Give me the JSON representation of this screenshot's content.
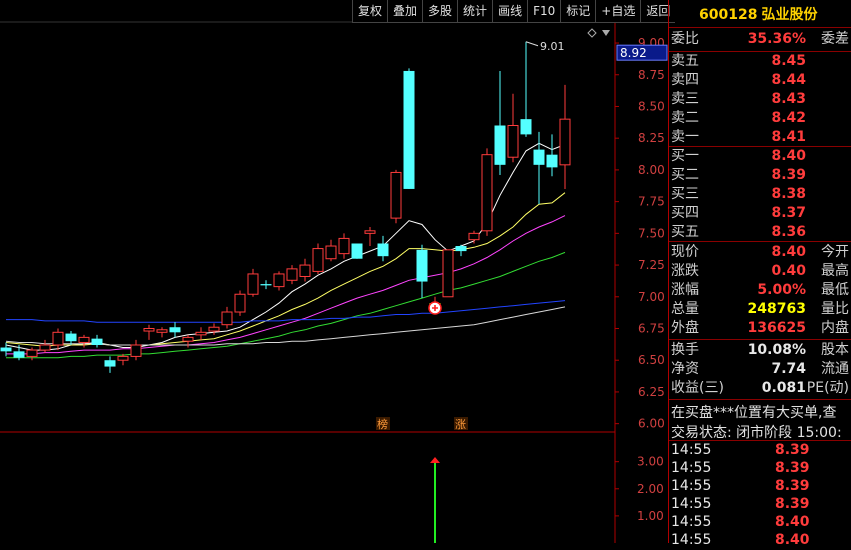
{
  "toolbar": [
    "复权",
    "叠加",
    "多股",
    "统计",
    "画线",
    "F10",
    "标记",
    "+自选",
    "返回"
  ],
  "stock": {
    "code": "600128",
    "name": "弘业股份"
  },
  "quote": {
    "ratio": {
      "label": "委比",
      "value": "35.36%",
      "label2": "委差"
    },
    "asks": [
      {
        "label": "卖五",
        "price": "8.45"
      },
      {
        "label": "卖四",
        "price": "8.44"
      },
      {
        "label": "卖三",
        "price": "8.43"
      },
      {
        "label": "卖二",
        "price": "8.42"
      },
      {
        "label": "卖一",
        "price": "8.41"
      }
    ],
    "bids": [
      {
        "label": "买一",
        "price": "8.40"
      },
      {
        "label": "买二",
        "price": "8.39"
      },
      {
        "label": "买三",
        "price": "8.38"
      },
      {
        "label": "买四",
        "price": "8.37"
      },
      {
        "label": "买五",
        "price": "8.36"
      }
    ],
    "stats": [
      {
        "label": "现价",
        "value": "8.40",
        "label2": "今开",
        "color": "red"
      },
      {
        "label": "涨跌",
        "value": "0.40",
        "label2": "最高",
        "color": "red"
      },
      {
        "label": "涨幅",
        "value": "5.00%",
        "label2": "最低",
        "color": "red"
      },
      {
        "label": "总量",
        "value": "248763",
        "label2": "量比",
        "color": "yel"
      },
      {
        "label": "外盘",
        "value": "136625",
        "label2": "内盘",
        "color": "red"
      }
    ],
    "fundamentals": [
      {
        "label": "换手",
        "value": "10.08%",
        "label2": "股本"
      },
      {
        "label": "净资",
        "value": "7.74",
        "label2": "流通"
      },
      {
        "label": "收益(三)",
        "value": "0.081",
        "label2": "PE(动)"
      }
    ],
    "scroll_note": "在买盘***位置有大买单,查",
    "trade_status": "交易状态: 闭市阶段  15:00:",
    "ticks": [
      {
        "time": "14:55",
        "price": "8.39"
      },
      {
        "time": "14:55",
        "price": "8.39"
      },
      {
        "time": "14:55",
        "price": "8.39"
      },
      {
        "time": "14:55",
        "price": "8.39"
      },
      {
        "time": "14:55",
        "price": "8.40"
      },
      {
        "time": "14:55",
        "price": "8.40"
      }
    ]
  },
  "colors": {
    "up": "#ff3c3c",
    "down": "#54ffff",
    "limit_up": "#ffff00",
    "axis": "#b00000"
  },
  "chart_data": {
    "type": "candlestick",
    "price_axis": {
      "ticks": [
        "9.00",
        "8.75",
        "8.50",
        "8.25",
        "8.00",
        "7.75",
        "7.50",
        "7.25",
        "7.00",
        "6.75",
        "6.50",
        "6.25",
        "6.00"
      ],
      "ylim": [
        5.95,
        9.15
      ]
    },
    "current_price_tag": "8.92",
    "max_label": "9.01",
    "markers": [
      "榜",
      "涨"
    ],
    "candles": [
      {
        "o": 6.6,
        "h": 6.64,
        "l": 6.53,
        "c": 6.57
      },
      {
        "o": 6.57,
        "h": 6.62,
        "l": 6.5,
        "c": 6.52
      },
      {
        "o": 6.53,
        "h": 6.6,
        "l": 6.5,
        "c": 6.58
      },
      {
        "o": 6.58,
        "h": 6.66,
        "l": 6.56,
        "c": 6.62
      },
      {
        "o": 6.62,
        "h": 6.75,
        "l": 6.58,
        "c": 6.72
      },
      {
        "o": 6.71,
        "h": 6.73,
        "l": 6.62,
        "c": 6.65
      },
      {
        "o": 6.64,
        "h": 6.7,
        "l": 6.6,
        "c": 6.68
      },
      {
        "o": 6.67,
        "h": 6.7,
        "l": 6.6,
        "c": 6.62
      },
      {
        "o": 6.5,
        "h": 6.53,
        "l": 6.4,
        "c": 6.45
      },
      {
        "o": 6.5,
        "h": 6.55,
        "l": 6.46,
        "c": 6.53
      },
      {
        "o": 6.53,
        "h": 6.66,
        "l": 6.5,
        "c": 6.62
      },
      {
        "o": 6.73,
        "h": 6.78,
        "l": 6.66,
        "c": 6.75
      },
      {
        "o": 6.72,
        "h": 6.76,
        "l": 6.68,
        "c": 6.74
      },
      {
        "o": 6.76,
        "h": 6.8,
        "l": 6.68,
        "c": 6.72
      },
      {
        "o": 6.65,
        "h": 6.7,
        "l": 6.6,
        "c": 6.68
      },
      {
        "o": 6.7,
        "h": 6.76,
        "l": 6.66,
        "c": 6.72
      },
      {
        "o": 6.73,
        "h": 6.79,
        "l": 6.7,
        "c": 6.76
      },
      {
        "o": 6.78,
        "h": 6.92,
        "l": 6.75,
        "c": 6.88
      },
      {
        "o": 6.88,
        "h": 7.05,
        "l": 6.85,
        "c": 7.02
      },
      {
        "o": 7.02,
        "h": 7.22,
        "l": 7.0,
        "c": 7.18
      },
      {
        "o": 7.1,
        "h": 7.13,
        "l": 7.06,
        "c": 7.09
      },
      {
        "o": 7.08,
        "h": 7.2,
        "l": 7.05,
        "c": 7.18
      },
      {
        "o": 7.13,
        "h": 7.25,
        "l": 7.1,
        "c": 7.22
      },
      {
        "o": 7.16,
        "h": 7.3,
        "l": 7.12,
        "c": 7.25
      },
      {
        "o": 7.2,
        "h": 7.42,
        "l": 7.18,
        "c": 7.38
      },
      {
        "o": 7.3,
        "h": 7.45,
        "l": 7.28,
        "c": 7.4
      },
      {
        "o": 7.34,
        "h": 7.5,
        "l": 7.3,
        "c": 7.46
      },
      {
        "o": 7.42,
        "h": 7.3,
        "l": 7.3,
        "c": 7.3
      },
      {
        "o": 7.5,
        "h": 7.55,
        "l": 7.4,
        "c": 7.52
      },
      {
        "o": 7.42,
        "h": 7.48,
        "l": 7.28,
        "c": 7.32
      },
      {
        "o": 7.62,
        "h": 8.0,
        "l": 7.58,
        "c": 7.98
      },
      {
        "o": 8.78,
        "h": 8.8,
        "l": 7.85,
        "c": 7.85
      },
      {
        "o": 7.37,
        "h": 7.41,
        "l": 6.99,
        "c": 7.12
      },
      {
        "o": 6.92,
        "h": 7.0,
        "l": 6.88,
        "c": 6.95
      },
      {
        "o": 7.0,
        "h": 7.37,
        "l": 7.0,
        "c": 7.37
      },
      {
        "o": 7.4,
        "h": 7.41,
        "l": 7.32,
        "c": 7.36
      },
      {
        "o": 7.45,
        "h": 7.52,
        "l": 7.42,
        "c": 7.5
      },
      {
        "o": 7.52,
        "h": 8.17,
        "l": 7.48,
        "c": 8.12
      },
      {
        "o": 8.35,
        "h": 8.78,
        "l": 7.96,
        "c": 8.04
      },
      {
        "o": 8.1,
        "h": 8.6,
        "l": 8.06,
        "c": 8.35
      },
      {
        "o": 8.4,
        "h": 9.01,
        "l": 8.26,
        "c": 8.28
      },
      {
        "o": 8.16,
        "h": 8.3,
        "l": 7.73,
        "c": 8.04
      },
      {
        "o": 8.12,
        "h": 8.28,
        "l": 7.95,
        "c": 8.02
      },
      {
        "o": 8.04,
        "h": 8.67,
        "l": 7.85,
        "c": 8.4
      }
    ],
    "moving_averages": [
      {
        "color": "#ffffff",
        "values": [
          6.62,
          6.6,
          6.58,
          6.58,
          6.59,
          6.62,
          6.63,
          6.64,
          6.62,
          6.6,
          6.6,
          6.62,
          6.64,
          6.68,
          6.7,
          6.71,
          6.72,
          6.73,
          6.76,
          6.82,
          6.88,
          6.95,
          7.04,
          7.1,
          7.17,
          7.22,
          7.28,
          7.32,
          7.36,
          7.4,
          7.5,
          7.6,
          7.57,
          7.45,
          7.36,
          7.4,
          7.44,
          7.58,
          7.8,
          7.98,
          8.15,
          8.21,
          8.16,
          8.2
        ]
      },
      {
        "color": "#ffff66",
        "values": [
          6.64,
          6.63,
          6.62,
          6.61,
          6.62,
          6.62,
          6.62,
          6.63,
          6.62,
          6.62,
          6.62,
          6.62,
          6.63,
          6.64,
          6.65,
          6.66,
          6.67,
          6.7,
          6.73,
          6.77,
          6.81,
          6.85,
          6.9,
          6.94,
          6.99,
          7.05,
          7.1,
          7.15,
          7.2,
          7.24,
          7.3,
          7.38,
          7.38,
          7.37,
          7.36,
          7.37,
          7.39,
          7.42,
          7.48,
          7.55,
          7.65,
          7.73,
          7.74,
          7.82
        ]
      },
      {
        "color": "#ff44ff",
        "values": [
          6.55,
          6.55,
          6.55,
          6.56,
          6.56,
          6.57,
          6.58,
          6.58,
          6.58,
          6.59,
          6.59,
          6.6,
          6.61,
          6.62,
          6.62,
          6.63,
          6.64,
          6.66,
          6.68,
          6.71,
          6.74,
          6.77,
          6.8,
          6.83,
          6.87,
          6.91,
          6.95,
          6.99,
          7.02,
          7.05,
          7.09,
          7.13,
          7.15,
          7.17,
          7.19,
          7.22,
          7.26,
          7.31,
          7.37,
          7.44,
          7.5,
          7.55,
          7.59,
          7.64
        ]
      },
      {
        "color": "#33dd33",
        "values": [
          6.52,
          6.52,
          6.52,
          6.52,
          6.52,
          6.53,
          6.53,
          6.54,
          6.54,
          6.54,
          6.55,
          6.55,
          6.56,
          6.57,
          6.58,
          6.59,
          6.6,
          6.61,
          6.63,
          6.65,
          6.67,
          6.69,
          6.72,
          6.74,
          6.77,
          6.79,
          6.82,
          6.85,
          6.87,
          6.9,
          6.93,
          6.96,
          6.99,
          7.02,
          7.05,
          7.07,
          7.1,
          7.13,
          7.16,
          7.2,
          7.24,
          7.28,
          7.31,
          7.35
        ]
      },
      {
        "color": "#2244ff",
        "values": [
          6.82,
          6.82,
          6.82,
          6.81,
          6.81,
          6.81,
          6.81,
          6.8,
          6.8,
          6.8,
          6.8,
          6.8,
          6.8,
          6.8,
          6.8,
          6.8,
          6.8,
          6.8,
          6.8,
          6.81,
          6.81,
          6.81,
          6.82,
          6.82,
          6.82,
          6.83,
          6.83,
          6.84,
          6.84,
          6.85,
          6.86,
          6.86,
          6.87,
          6.87,
          6.88,
          6.89,
          6.9,
          6.91,
          6.92,
          6.93,
          6.94,
          6.95,
          6.96,
          6.97
        ]
      },
      {
        "color": "#d8d8d8",
        "values": [
          6.65,
          6.64,
          6.64,
          6.63,
          6.63,
          6.63,
          6.63,
          6.63,
          6.62,
          6.62,
          6.62,
          6.62,
          6.62,
          6.62,
          6.62,
          6.62,
          6.62,
          6.63,
          6.63,
          6.63,
          6.64,
          6.64,
          6.65,
          6.65,
          6.66,
          6.67,
          6.68,
          6.69,
          6.7,
          6.71,
          6.72,
          6.73,
          6.74,
          6.75,
          6.76,
          6.77,
          6.78,
          6.8,
          6.82,
          6.84,
          6.86,
          6.88,
          6.9,
          6.92
        ]
      }
    ],
    "volume_axis": {
      "ticks": [
        "3.00",
        "2.00",
        "1.00"
      ],
      "ylim": [
        0.0,
        3.8
      ]
    },
    "volume_bar": {
      "index": 33,
      "value": 3.1
    }
  }
}
